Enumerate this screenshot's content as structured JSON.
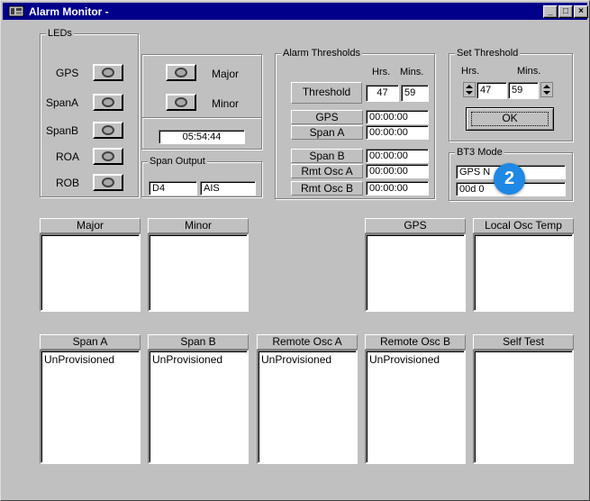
{
  "window": {
    "title": "Alarm Monitor -",
    "minimize_glyph": "_",
    "restore_glyph": "□",
    "close_glyph": "×"
  },
  "leds": {
    "group_label": "LEDs",
    "items": [
      {
        "label": "GPS"
      },
      {
        "label": "SpanA"
      },
      {
        "label": "SpanB"
      },
      {
        "label": "ROA"
      },
      {
        "label": "ROB"
      }
    ]
  },
  "status_leds": {
    "major_label": "Major",
    "minor_label": "Minor",
    "clock": "05:54:44"
  },
  "span_output": {
    "group_label": "Span Output",
    "value1": "D4",
    "value2": "AIS"
  },
  "alarm_thresholds": {
    "group_label": "Alarm Thresholds",
    "hrs_label": "Hrs.",
    "mins_label": "Mins.",
    "threshold_label": "Threshold",
    "threshold_hrs": "47",
    "threshold_mins": "59",
    "rows": [
      {
        "label": "GPS",
        "value": "00:00:00"
      },
      {
        "label": "Span A",
        "value": "00:00:00"
      },
      {
        "label": "Span B",
        "value": "00:00:00"
      },
      {
        "label": "Rmt Osc A",
        "value": "00:00:00"
      },
      {
        "label": "Rmt Osc B",
        "value": "00:00:00"
      }
    ]
  },
  "set_threshold": {
    "group_label": "Set Threshold",
    "hrs_label": "Hrs.",
    "mins_label": "Mins.",
    "hrs_value": "47",
    "mins_value": "59",
    "ok_label": "OK"
  },
  "bt3_mode": {
    "group_label": "BT3 Mode",
    "line1": "GPS N",
    "line2": "00d 0"
  },
  "badge": {
    "number": "2",
    "color": "#1e88e5"
  },
  "panels_top": [
    {
      "header": "Major",
      "content": ""
    },
    {
      "header": "Minor",
      "content": ""
    },
    {
      "header": "GPS",
      "content": ""
    },
    {
      "header": "Local Osc Temp",
      "content": ""
    }
  ],
  "panels_bottom": [
    {
      "header": "Span A",
      "content": "UnProvisioned"
    },
    {
      "header": "Span B",
      "content": "UnProvisioned"
    },
    {
      "header": "Remote Osc A",
      "content": "UnProvisioned"
    },
    {
      "header": "Remote Osc B",
      "content": "UnProvisioned"
    },
    {
      "header": "Self Test",
      "content": ""
    }
  ]
}
